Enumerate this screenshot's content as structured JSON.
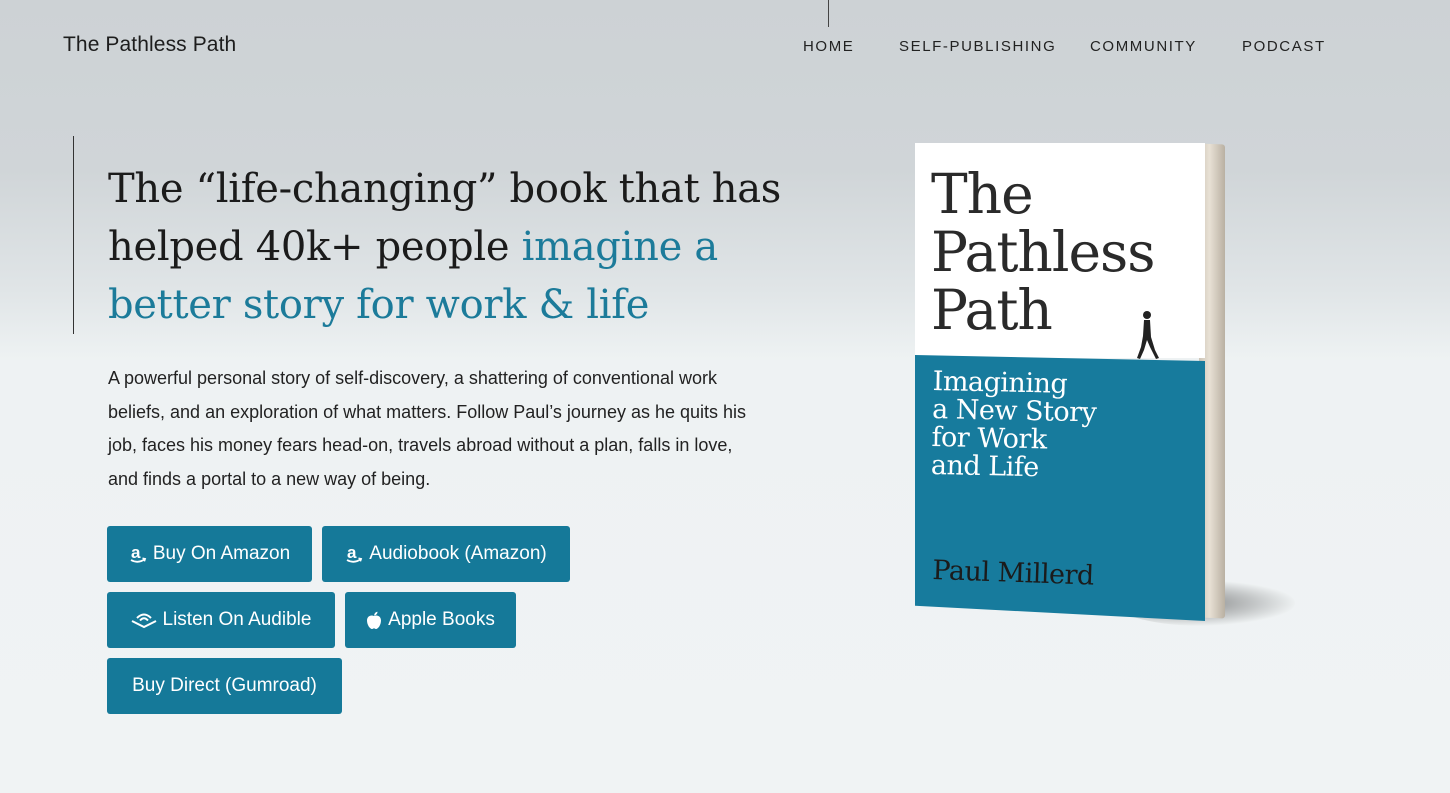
{
  "header": {
    "site_title": "The Pathless Path",
    "nav": [
      "HOME",
      "SELF-PUBLISHING",
      "COMMUNITY",
      "PODCAST"
    ]
  },
  "hero": {
    "headline_part1": "The “life-changing” book that has helped 40k+ people ",
    "headline_accent": "imagine a better story for work & life",
    "description": "A powerful personal story of self-discovery, a shattering of conventional work beliefs, and an exploration of what matters. Follow Paul’s journey as he quits his job, faces his money fears head-on, travels abroad without a plan, falls in love, and finds a portal to a new way of being."
  },
  "buttons": {
    "buy_amazon": "Buy On Amazon",
    "audiobook_amazon": "Audiobook (Amazon)",
    "listen_audible": "Listen On Audible",
    "apple_books": "Apple Books",
    "buy_direct": "Buy Direct (Gumroad)"
  },
  "book": {
    "title": "The\nPathless\nPath",
    "subtitle": "Imagining\na New Story\nfor Work\nand Life",
    "author": "Paul Millerd"
  },
  "icons": {
    "amazon": "amazon-icon",
    "audible": "audible-icon",
    "apple": "apple-icon"
  },
  "colors": {
    "accent": "#1c7b9a",
    "button": "#157999",
    "cover_blue": "#177b9d"
  }
}
